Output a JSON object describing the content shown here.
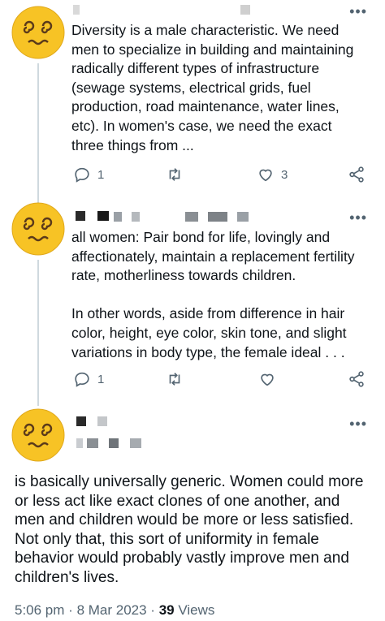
{
  "tweets": [
    {
      "text": "Diversity is a male characteristic. We need men to specialize in building and maintaining radically different types of infrastructure (sewage systems, electrical grids, fuel production, road maintenance, water lines, etc). In women's case, we need the exact three things from ...",
      "replies": "1",
      "likes": "3"
    },
    {
      "text": "all women: Pair bond for life, lovingly and affectionately, maintain a replacement fertility rate, motherliness towards children.\n\nIn other words, aside from difference in hair color, height, eye color, skin tone, and slight variations in body type, the female ideal . . .",
      "replies": "1",
      "likes": ""
    }
  ],
  "main_tweet": {
    "text": "is basically universally generic. Women could more or less act like exact clones of one another, and men and children would be more or less satisfied. Not only that, this sort of uniformity in female behavior would probably vastly improve men and children's lives.",
    "time": "5:06 pm",
    "date": "8 Mar 2023",
    "views_count": "39",
    "views_label": "Views"
  },
  "icons": {
    "avatar": "dizzy-face-emoji",
    "more": "more-dots-icon",
    "reply": "reply-icon",
    "retweet": "retweet-icon",
    "like": "like-icon",
    "share": "share-icon"
  },
  "colors": {
    "text": "#0f1419",
    "secondary": "#536471",
    "thread_line": "#cfd9de",
    "emoji_face": "#f7c325"
  }
}
